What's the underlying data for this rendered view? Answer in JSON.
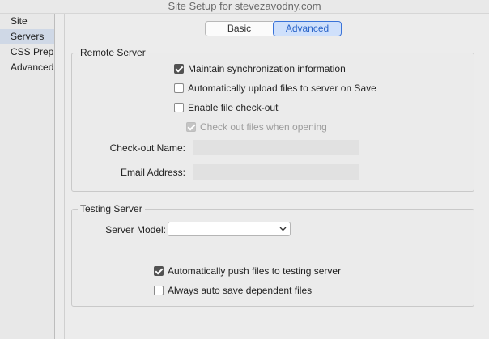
{
  "window": {
    "title": "Site Setup for stevezavodny.com"
  },
  "sidebar": {
    "items": [
      {
        "label": "Site",
        "selected": false
      },
      {
        "label": "Servers",
        "selected": true
      },
      {
        "label": "CSS Preprocessors",
        "selected": false
      },
      {
        "label": "Advanced Settings",
        "selected": false
      }
    ]
  },
  "tabs": {
    "basic": "Basic",
    "advanced": "Advanced",
    "active": "Advanced"
  },
  "remote_server": {
    "title": "Remote Server",
    "maintain_sync": {
      "label": "Maintain synchronization information",
      "checked": true
    },
    "auto_upload": {
      "label": "Automatically upload files to server on Save",
      "checked": false
    },
    "enable_checkout": {
      "label": "Enable file check-out",
      "checked": false
    },
    "checkout_when_opening": {
      "label": "Check out files when opening",
      "checked": true,
      "disabled": true
    },
    "checkout_name": {
      "label": "Check-out Name:",
      "value": ""
    },
    "email_address": {
      "label": "Email Address:",
      "value": ""
    }
  },
  "testing_server": {
    "title": "Testing Server",
    "server_model": {
      "label": "Server Model:",
      "value": ""
    },
    "auto_push": {
      "label": "Automatically push files to testing server",
      "checked": true
    },
    "auto_save_dependent": {
      "label": "Always auto save dependent files",
      "checked": false
    }
  },
  "icons": {
    "dropdown": "chevron-down-icon",
    "check": "checkmark-icon"
  }
}
